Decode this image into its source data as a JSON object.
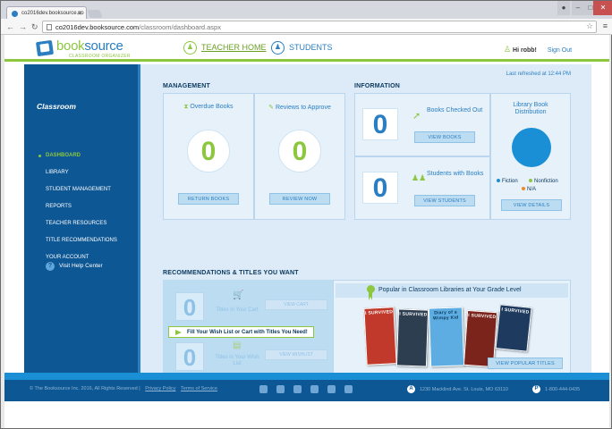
{
  "browser": {
    "tab_title": "co2016dev.booksource.co",
    "url_host": "co2016dev.booksource.com",
    "url_path": "/classroom/dashboard.aspx"
  },
  "header": {
    "logo_book": "book",
    "logo_source": "source",
    "logo_sub": "CLASSROOM ORGANIZER",
    "nav_teacher_home": "TEACHER HOME",
    "nav_students": "STUDENTS",
    "greeting": "Hi robb!",
    "signout": "Sign Out"
  },
  "sidebar": {
    "title": "Classroom",
    "items": [
      {
        "label": "DASHBOARD"
      },
      {
        "label": "LIBRARY"
      },
      {
        "label": "STUDENT MANAGEMENT"
      },
      {
        "label": "REPORTS"
      },
      {
        "label": "TEACHER RESOURCES"
      },
      {
        "label": "TITLE RECOMMENDATIONS"
      },
      {
        "label": "YOUR ACCOUNT"
      }
    ],
    "help": "Visit Help Center"
  },
  "main": {
    "refreshed": "Last refreshed at 12:44 PM",
    "management": {
      "title": "MANAGEMENT",
      "overdue": {
        "label": "Overdue Books",
        "count": "0",
        "button": "RETURN BOOKS"
      },
      "reviews": {
        "label": "Reviews to Approve",
        "count": "0",
        "button": "REVIEW NOW"
      }
    },
    "information": {
      "title": "INFORMATION",
      "checked_out": {
        "label": "Books Checked Out",
        "count": "0",
        "button": "VIEW BOOKS"
      },
      "students": {
        "label": "Students with Books",
        "count": "0",
        "button": "VIEW STUDENTS"
      },
      "distribution": {
        "label": "Library Book Distribution",
        "legend": [
          {
            "name": "Fiction",
            "color": "#1a8fd6"
          },
          {
            "name": "Nonfiction",
            "color": "#8dc63f"
          },
          {
            "name": "N/A",
            "color": "#f08a24"
          }
        ],
        "button": "VIEW DETAILS"
      }
    },
    "recommendations": {
      "title": "RECOMMENDATIONS & TITLES YOU WANT",
      "cart": {
        "count": "0",
        "label": "Titles in Your Cart",
        "button": "VIEW CART"
      },
      "wishlist": {
        "count": "0",
        "label": "Titles in Your Wish List",
        "button": "VIEW WISHLIST"
      },
      "tip": "Fill Your Wish List or Cart with Titles You Need!",
      "popular": "Popular in Classroom Libraries at Your Grade Level",
      "books": [
        {
          "title": "I SURVIVED",
          "color": "#c0392b"
        },
        {
          "title": "I SURVIVED",
          "color": "#2c3e50"
        },
        {
          "title": "Diary of a Wimpy Kid",
          "color": "#5dade2"
        },
        {
          "title": "I SURVIVED",
          "color": "#7b241c"
        },
        {
          "title": "I SURVIVED",
          "color": "#1f3a5f"
        }
      ],
      "popular_button": "VIEW POPULAR TITLES"
    }
  },
  "footer": {
    "copyright": "© The Booksource Inc. 2016, All Rights Reserved",
    "privacy": "Privacy Policy",
    "terms": "Terms of Service",
    "address": "1230 Macklind Ave. St. Louis, MO 63110",
    "phone": "1-800-444-0435"
  }
}
